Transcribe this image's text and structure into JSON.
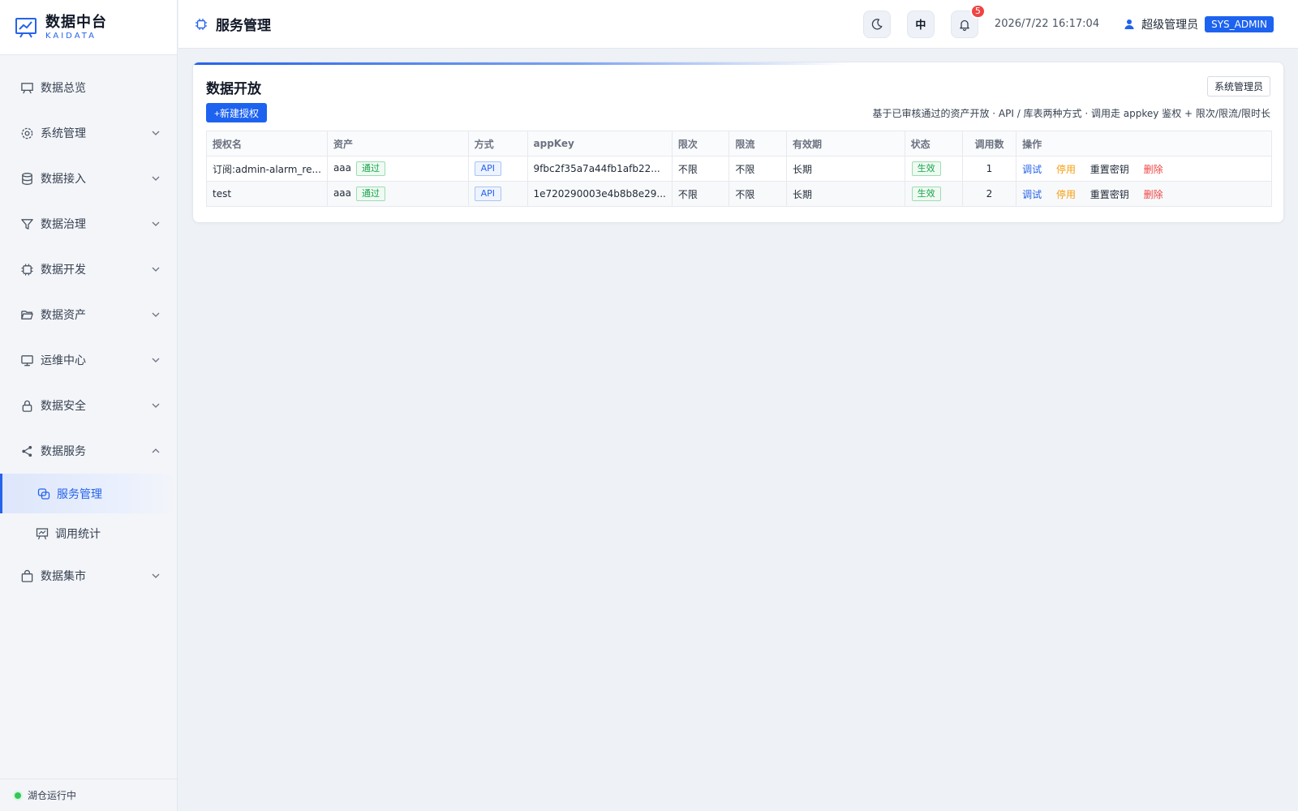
{
  "brand": {
    "title": "数据中台",
    "subtitle": "KAIDATA"
  },
  "sidebar": {
    "items": [
      {
        "label": "数据总览",
        "icon": "monitor-chart-icon",
        "expandable": false
      },
      {
        "label": "系统管理",
        "icon": "gear-icon",
        "expandable": true
      },
      {
        "label": "数据接入",
        "icon": "database-icon",
        "expandable": true
      },
      {
        "label": "数据治理",
        "icon": "filter-icon",
        "expandable": true
      },
      {
        "label": "数据开发",
        "icon": "chip-icon",
        "expandable": true
      },
      {
        "label": "数据资产",
        "icon": "folder-open-icon",
        "expandable": true
      },
      {
        "label": "运维中心",
        "icon": "monitor-icon",
        "expandable": true
      },
      {
        "label": "数据安全",
        "icon": "lock-icon",
        "expandable": true
      },
      {
        "label": "数据服务",
        "icon": "share-icon",
        "expandable": true,
        "expanded": true
      },
      {
        "label": "数据集市",
        "icon": "shopping-bag-icon",
        "expandable": true
      }
    ],
    "service_children": [
      {
        "label": "服务管理",
        "icon": "service-icon",
        "active": true
      },
      {
        "label": "调用统计",
        "icon": "presentation-chart-icon",
        "active": false
      }
    ],
    "footer_status": "湖仓运行中"
  },
  "header": {
    "title": "服务管理",
    "lang_label": "中",
    "notification_count": "5",
    "datetime": "2026/7/22 16:17:04",
    "user_name": "超级管理员",
    "role": "SYS_ADMIN"
  },
  "main": {
    "card_title": "数据开放",
    "role_chip": "系统管理员",
    "new_button": "+新建授权",
    "description": "基于已审核通过的资产开放 · API / 库表两种方式 · 调用走 appkey 鉴权 + 限次/限流/限时长",
    "table": {
      "columns": [
        "授权名",
        "资产",
        "方式",
        "appKey",
        "限次",
        "限流",
        "有效期",
        "状态",
        "调用数",
        "操作"
      ],
      "rows": [
        {
          "name": "订阅:admin-alarm_re...",
          "asset": "aaa",
          "asset_status": "通过",
          "method": "API",
          "appkey": "9fbc2f35a7a44fb1afb22...",
          "limit_count": "不限",
          "limit_rate": "不限",
          "validity": "长期",
          "status": "生效",
          "calls": "1"
        },
        {
          "name": "test",
          "asset": "aaa",
          "asset_status": "通过",
          "method": "API",
          "appkey": "1e720290003e4b8b8e29...",
          "limit_count": "不限",
          "limit_rate": "不限",
          "validity": "长期",
          "status": "生效",
          "calls": "2"
        }
      ],
      "actions": {
        "debug": "调试",
        "disable": "停用",
        "reset_key": "重置密钥",
        "delete": "删除"
      }
    }
  },
  "colors": {
    "accent": "#1d63f0",
    "success": "#16a34a",
    "warning": "#f59e0b",
    "danger": "#ef4444",
    "background": "#eef1f6"
  }
}
